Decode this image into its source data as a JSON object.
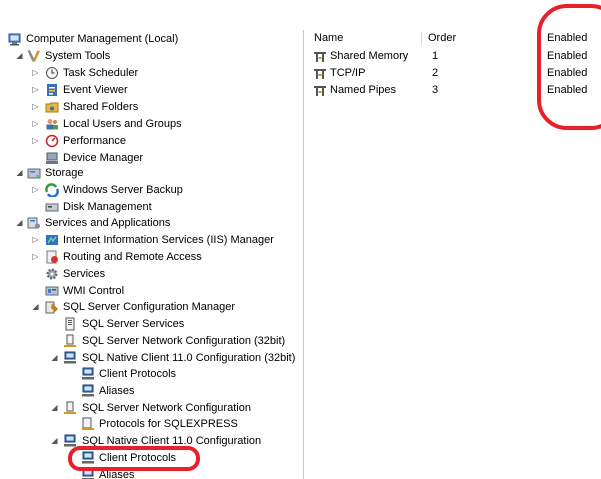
{
  "tree": {
    "root": {
      "label": "Computer Management (Local)",
      "icon": "computer-management-icon"
    },
    "system_tools": {
      "label": "System Tools",
      "icon": "tools-icon",
      "items": [
        {
          "label": "Task Scheduler",
          "icon": "clock-icon"
        },
        {
          "label": "Event Viewer",
          "icon": "event-viewer-icon"
        },
        {
          "label": "Shared Folders",
          "icon": "shared-folder-icon"
        },
        {
          "label": "Local Users and Groups",
          "icon": "users-icon"
        },
        {
          "label": "Performance",
          "icon": "performance-icon"
        },
        {
          "label": "Device Manager",
          "icon": "device-manager-icon"
        }
      ]
    },
    "storage": {
      "label": "Storage",
      "icon": "storage-icon",
      "items": [
        {
          "label": "Windows Server Backup",
          "icon": "backup-icon"
        },
        {
          "label": "Disk Management",
          "icon": "disk-icon"
        }
      ]
    },
    "services_apps": {
      "label": "Services and Applications",
      "icon": "services-apps-icon",
      "items": [
        {
          "label": "Internet Information Services (IIS) Manager",
          "icon": "iis-icon"
        },
        {
          "label": "Routing and Remote Access",
          "icon": "routing-icon"
        },
        {
          "label": "Services",
          "icon": "gear-icon"
        },
        {
          "label": "WMI Control",
          "icon": "wmi-icon"
        }
      ]
    },
    "sql_config": {
      "label": "SQL Server Configuration Manager",
      "icon": "sql-config-icon",
      "services": "SQL Server Services",
      "network_32": "SQL Server Network Configuration (32bit)",
      "native_32": {
        "label": "SQL Native Client 11.0 Configuration (32bit)",
        "client_protocols": "Client Protocols",
        "aliases": "Aliases"
      },
      "network": {
        "label": "SQL Server Network Configuration",
        "protocols": "Protocols for SQLEXPRESS"
      },
      "native": {
        "label": "SQL Native Client 11.0 Configuration",
        "client_protocols": "Client Protocols",
        "aliases": "Aliases"
      }
    }
  },
  "list": {
    "columns": [
      "Name",
      "Order",
      "Enabled"
    ],
    "rows": [
      {
        "name": "Shared Memory",
        "order": "1",
        "enabled": "Enabled"
      },
      {
        "name": "TCP/IP",
        "order": "2",
        "enabled": "Enabled"
      },
      {
        "name": "Named Pipes",
        "order": "3",
        "enabled": "Enabled"
      }
    ]
  },
  "colors": {
    "annotation": "#e8202a",
    "border": "#c8c8c8",
    "expander": "#555555"
  }
}
